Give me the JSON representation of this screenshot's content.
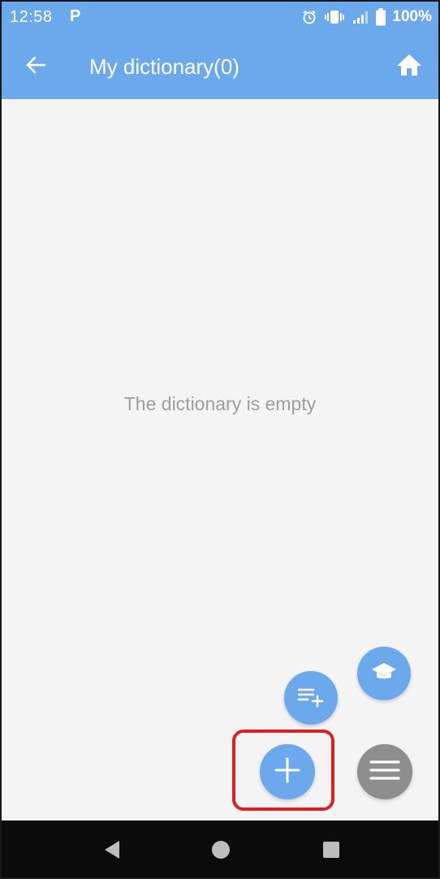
{
  "status_bar": {
    "time": "12:58",
    "notification_glyph": "P",
    "battery_percent": "100%",
    "icons": [
      "alarm-icon",
      "vibrate-icon",
      "signal-icon",
      "battery-icon"
    ]
  },
  "app_bar": {
    "title": "My dictionary(0)",
    "back_icon": "arrow-left-icon",
    "home_icon": "home-icon"
  },
  "content": {
    "empty_message": "The dictionary is empty"
  },
  "fabs": {
    "study": "graduation-cap-icon",
    "add_list": "playlist-add-icon",
    "add": "plus-icon",
    "menu": "menu-icon"
  },
  "nav_bar": {
    "icons": [
      "nav-back-icon",
      "nav-home-icon",
      "nav-recent-icon"
    ]
  },
  "colors": {
    "primary": "#6ca9ec",
    "background": "#f4f4f4",
    "empty_text": "#9e9e9e",
    "menu_fab": "#8e8e8e",
    "highlight": "#e02020",
    "nav_bar": "#0b0b0b"
  }
}
